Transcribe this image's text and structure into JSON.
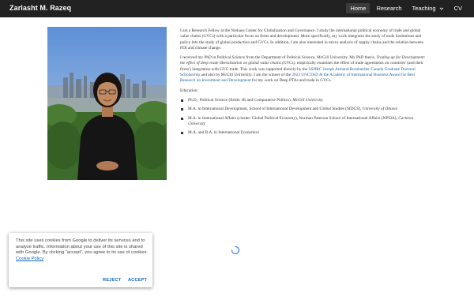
{
  "header": {
    "site_title": "Zarlasht M. Razeq",
    "nav": [
      {
        "label": "Home",
        "active": true
      },
      {
        "label": "Research"
      },
      {
        "label": "Teaching",
        "has_dropdown": true
      },
      {
        "label": "CV"
      }
    ],
    "bar_color": "#212121"
  },
  "bio": {
    "p1": "I am a Research Fellow at the Niehaus Center for Globalization and Governance. I study the international political economy of trade and global value chains (GVCs) with a particular focus on firms and development. More specifically, my work integrates the study of trade institutions and policy into the study of global production and GVCs. In addition, I am also interested in micro analysis of supply chains and the relation between FDI and climate change.",
    "p2_a": "I received my PhD in Political Science from the Department of Political Science, McGill University. My PhD thesis, ",
    "p2_thesis": "Trading up for Development: the effect of deep trade liberalization on global value chains (GVCs)",
    "p2_b": ", empirically examines the effect of trade agreements on countries' (and their firms') integration with GVC trade. This work was supported directly by the ",
    "p2_link1": "SSHRC Joseph Armand Bombardier Canada Graduate Doctoral Scholarship",
    "p2_c": " and also by McGill University. I am the winner of the ",
    "p2_link2": "2022 UNCTAD & the Academy of International Business Award for Best Research on Investment and Development",
    "p2_d": " for my work on Deep PTAs and trade in GVCs."
  },
  "education": {
    "heading": "Education:",
    "items": [
      {
        "text": "Ph.D., Political Science (fields: IR and Comparative Politics), ",
        "institution": "McGill University"
      },
      {
        "text": "M.A. in International  Development, School of International Development and Global Studies (SIDGS), ",
        "institution": "University of Ottawa"
      },
      {
        "text": "M.A. in International Affairs (cluster: Global Political Economy), Norman Paterson School of International Affairs (NPSIA), ",
        "institution": "Carleton University"
      },
      {
        "text": "M.A. and B.A. in International Economics",
        "institution": ""
      }
    ]
  },
  "cookie": {
    "text": "This site uses cookies from Google to deliver its services and to analyze traffic. Information about your use of this site is shared with Google. By clicking \"accept\", you agree to its use of cookies. ",
    "link": "Cookie Policy",
    "reject": "REJECT",
    "accept": "ACCEPT",
    "accent": "#1565c0"
  }
}
